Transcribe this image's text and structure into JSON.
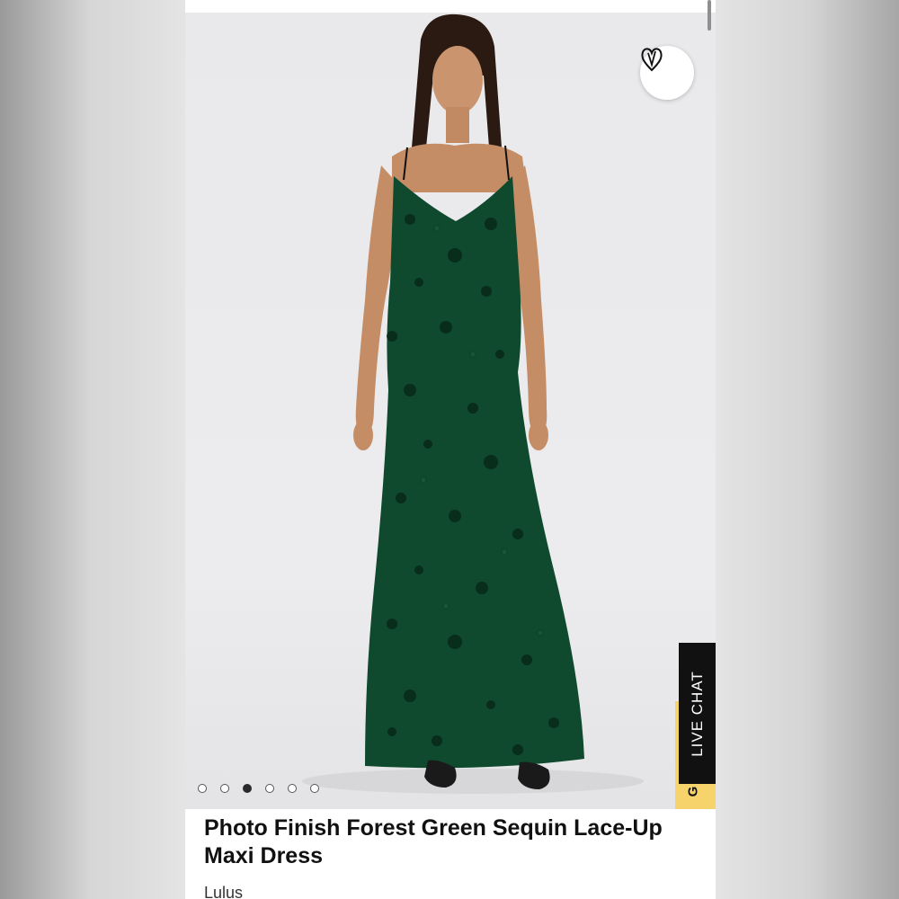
{
  "product": {
    "title": "Photo Finish Forest Green Sequin Lace-Up Maxi Dress",
    "brand": "Lulus"
  },
  "gallery": {
    "image_count": 6,
    "active_index": 2,
    "dress_color": "#0f4a2e"
  },
  "live_chat": {
    "label": "LIVE CHAT",
    "tab_letter": "G"
  },
  "icons": {
    "wishlist": "heart-outline-icon"
  },
  "colors": {
    "accent_yellow": "#f6d36b",
    "chat_bg": "#111111"
  }
}
